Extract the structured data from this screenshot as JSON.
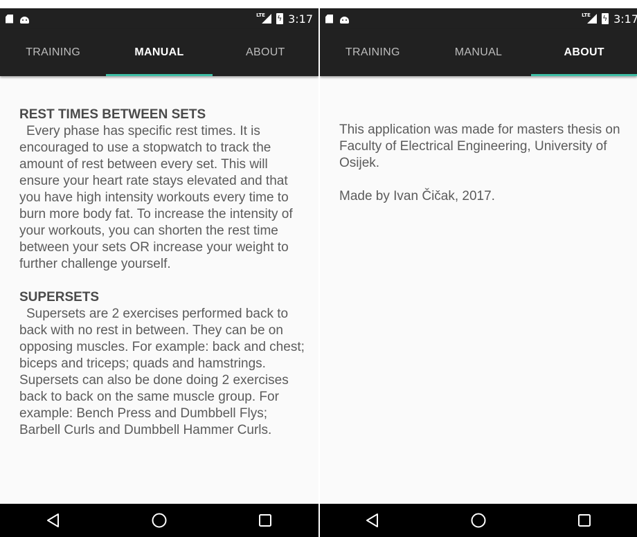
{
  "status_bar": {
    "network": "LTE",
    "time": "3:17"
  },
  "tabs": [
    {
      "label": "TRAINING"
    },
    {
      "label": "MANUAL"
    },
    {
      "label": "ABOUT"
    }
  ],
  "left_screen": {
    "active_tab": "MANUAL",
    "sections": [
      {
        "title": "REST TIMES BETWEEN SETS",
        "body": "Every phase has specific rest times. It is encouraged to use a stopwatch to track the amount of rest between every set. This will ensure your heart rate stays elevated and that you have high intensity workouts every time to burn more body fat. To increase the intensity of your workouts, you can shorten the rest time between your sets OR increase your weight to further challenge yourself."
      },
      {
        "title": "SUPERSETS",
        "body": "Supersets are 2 exercises performed back to back with no rest in between. They can be on opposing muscles. For example: back and chest; biceps and triceps; quads and hamstrings. Supersets can also be done doing 2 exercises back to back on the same muscle group. For example: Bench Press and Dumbbell Flys; Barbell Curls and Dumbbell Hammer Curls."
      }
    ]
  },
  "right_screen": {
    "active_tab": "ABOUT",
    "paragraphs": [
      "This application was made for masters thesis on Faculty of Electrical Engineering, University of Osijek.",
      "Made by Ivan Čičak, 2017."
    ]
  },
  "nav_bar": {
    "buttons": [
      "back-icon",
      "home-icon",
      "recents-icon"
    ]
  },
  "colors": {
    "bar_background": "#212121",
    "tab_indicator": "#3fbfa6",
    "content_background": "#fafafa",
    "text": "#5b5b5b"
  }
}
